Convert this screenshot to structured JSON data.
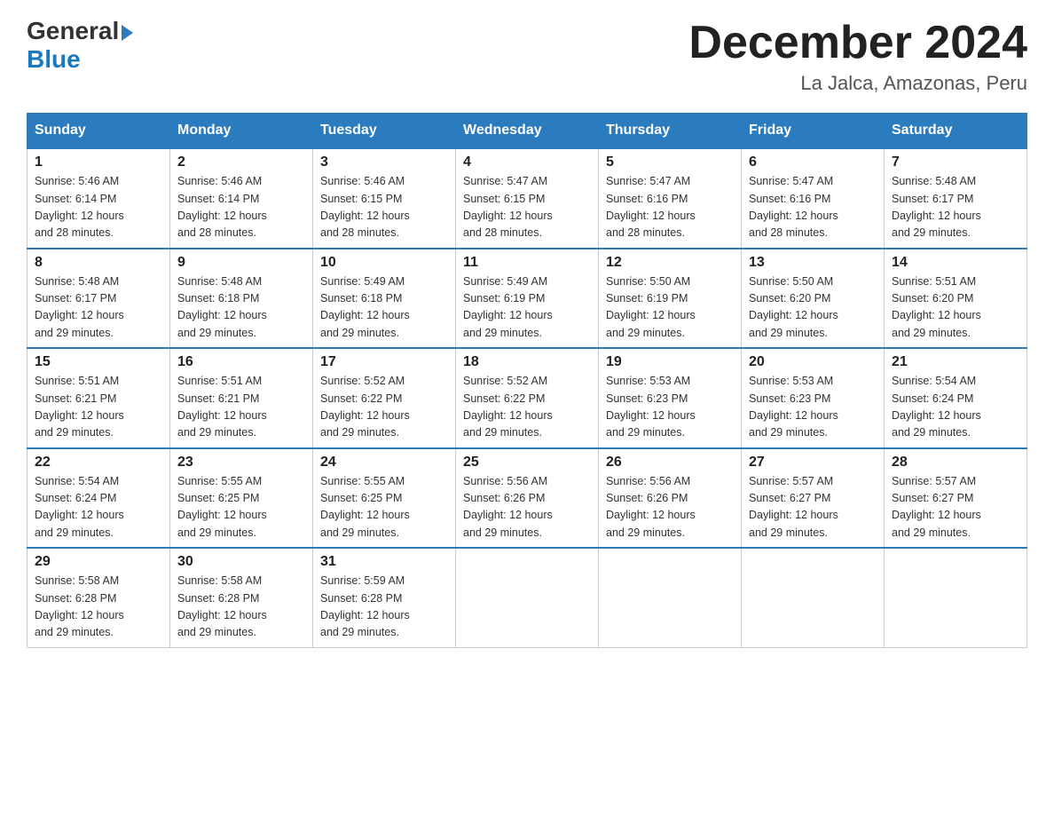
{
  "logo": {
    "line1": "General",
    "line2": "Blue"
  },
  "title": "December 2024",
  "subtitle": "La Jalca, Amazonas, Peru",
  "days_header": [
    "Sunday",
    "Monday",
    "Tuesday",
    "Wednesday",
    "Thursday",
    "Friday",
    "Saturday"
  ],
  "weeks": [
    [
      {
        "num": "1",
        "info": "Sunrise: 5:46 AM\nSunset: 6:14 PM\nDaylight: 12 hours\nand 28 minutes."
      },
      {
        "num": "2",
        "info": "Sunrise: 5:46 AM\nSunset: 6:14 PM\nDaylight: 12 hours\nand 28 minutes."
      },
      {
        "num": "3",
        "info": "Sunrise: 5:46 AM\nSunset: 6:15 PM\nDaylight: 12 hours\nand 28 minutes."
      },
      {
        "num": "4",
        "info": "Sunrise: 5:47 AM\nSunset: 6:15 PM\nDaylight: 12 hours\nand 28 minutes."
      },
      {
        "num": "5",
        "info": "Sunrise: 5:47 AM\nSunset: 6:16 PM\nDaylight: 12 hours\nand 28 minutes."
      },
      {
        "num": "6",
        "info": "Sunrise: 5:47 AM\nSunset: 6:16 PM\nDaylight: 12 hours\nand 28 minutes."
      },
      {
        "num": "7",
        "info": "Sunrise: 5:48 AM\nSunset: 6:17 PM\nDaylight: 12 hours\nand 29 minutes."
      }
    ],
    [
      {
        "num": "8",
        "info": "Sunrise: 5:48 AM\nSunset: 6:17 PM\nDaylight: 12 hours\nand 29 minutes."
      },
      {
        "num": "9",
        "info": "Sunrise: 5:48 AM\nSunset: 6:18 PM\nDaylight: 12 hours\nand 29 minutes."
      },
      {
        "num": "10",
        "info": "Sunrise: 5:49 AM\nSunset: 6:18 PM\nDaylight: 12 hours\nand 29 minutes."
      },
      {
        "num": "11",
        "info": "Sunrise: 5:49 AM\nSunset: 6:19 PM\nDaylight: 12 hours\nand 29 minutes."
      },
      {
        "num": "12",
        "info": "Sunrise: 5:50 AM\nSunset: 6:19 PM\nDaylight: 12 hours\nand 29 minutes."
      },
      {
        "num": "13",
        "info": "Sunrise: 5:50 AM\nSunset: 6:20 PM\nDaylight: 12 hours\nand 29 minutes."
      },
      {
        "num": "14",
        "info": "Sunrise: 5:51 AM\nSunset: 6:20 PM\nDaylight: 12 hours\nand 29 minutes."
      }
    ],
    [
      {
        "num": "15",
        "info": "Sunrise: 5:51 AM\nSunset: 6:21 PM\nDaylight: 12 hours\nand 29 minutes."
      },
      {
        "num": "16",
        "info": "Sunrise: 5:51 AM\nSunset: 6:21 PM\nDaylight: 12 hours\nand 29 minutes."
      },
      {
        "num": "17",
        "info": "Sunrise: 5:52 AM\nSunset: 6:22 PM\nDaylight: 12 hours\nand 29 minutes."
      },
      {
        "num": "18",
        "info": "Sunrise: 5:52 AM\nSunset: 6:22 PM\nDaylight: 12 hours\nand 29 minutes."
      },
      {
        "num": "19",
        "info": "Sunrise: 5:53 AM\nSunset: 6:23 PM\nDaylight: 12 hours\nand 29 minutes."
      },
      {
        "num": "20",
        "info": "Sunrise: 5:53 AM\nSunset: 6:23 PM\nDaylight: 12 hours\nand 29 minutes."
      },
      {
        "num": "21",
        "info": "Sunrise: 5:54 AM\nSunset: 6:24 PM\nDaylight: 12 hours\nand 29 minutes."
      }
    ],
    [
      {
        "num": "22",
        "info": "Sunrise: 5:54 AM\nSunset: 6:24 PM\nDaylight: 12 hours\nand 29 minutes."
      },
      {
        "num": "23",
        "info": "Sunrise: 5:55 AM\nSunset: 6:25 PM\nDaylight: 12 hours\nand 29 minutes."
      },
      {
        "num": "24",
        "info": "Sunrise: 5:55 AM\nSunset: 6:25 PM\nDaylight: 12 hours\nand 29 minutes."
      },
      {
        "num": "25",
        "info": "Sunrise: 5:56 AM\nSunset: 6:26 PM\nDaylight: 12 hours\nand 29 minutes."
      },
      {
        "num": "26",
        "info": "Sunrise: 5:56 AM\nSunset: 6:26 PM\nDaylight: 12 hours\nand 29 minutes."
      },
      {
        "num": "27",
        "info": "Sunrise: 5:57 AM\nSunset: 6:27 PM\nDaylight: 12 hours\nand 29 minutes."
      },
      {
        "num": "28",
        "info": "Sunrise: 5:57 AM\nSunset: 6:27 PM\nDaylight: 12 hours\nand 29 minutes."
      }
    ],
    [
      {
        "num": "29",
        "info": "Sunrise: 5:58 AM\nSunset: 6:28 PM\nDaylight: 12 hours\nand 29 minutes."
      },
      {
        "num": "30",
        "info": "Sunrise: 5:58 AM\nSunset: 6:28 PM\nDaylight: 12 hours\nand 29 minutes."
      },
      {
        "num": "31",
        "info": "Sunrise: 5:59 AM\nSunset: 6:28 PM\nDaylight: 12 hours\nand 29 minutes."
      },
      {
        "num": "",
        "info": ""
      },
      {
        "num": "",
        "info": ""
      },
      {
        "num": "",
        "info": ""
      },
      {
        "num": "",
        "info": ""
      }
    ]
  ]
}
